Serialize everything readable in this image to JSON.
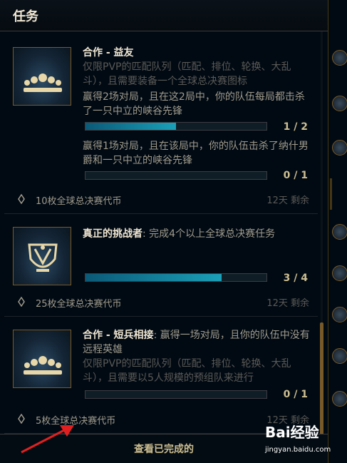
{
  "header": {
    "title": "任务"
  },
  "quests": [
    {
      "name": "合作 - 益友",
      "description": "仅限PVP的匹配队列（匹配、排位、轮换、大乱斗），且需要装备一个全球总决赛图标",
      "objectives": [
        {
          "text": "赢得2场对局，且在这2局中，你的队伍每局都击杀了一只中立的峡谷先锋",
          "progress": 0.5,
          "count": "1 / 2"
        },
        {
          "text": "赢得1场对局，且在该局中，你的队伍击杀了纳什男爵和一只中立的峡谷先锋",
          "progress": 0.0,
          "count": "0 / 1"
        }
      ],
      "reward": "10枚全球总决赛代币",
      "remaining": "12天 剩余",
      "icon": "team-icon"
    },
    {
      "name": "真正的挑战者",
      "title_suffix": ": 完成4个以上全球总决赛任务",
      "objectives": [
        {
          "text": "",
          "progress": 0.75,
          "count": "3 / 4"
        }
      ],
      "reward": "25枚全球总决赛代币",
      "remaining": "12天 剩余",
      "icon": "worlds-trophy-icon"
    },
    {
      "name": "合作 - 短兵相接",
      "title_suffix": ": 赢得一场对局，且你的队伍中没有远程英雄",
      "description": "仅限PVP的匹配队列（匹配、排位、轮换、大乱斗），且需要以5人规模的预组队来进行",
      "objectives": [
        {
          "text": "",
          "progress": 0.0,
          "count": "0 / 1"
        }
      ],
      "reward": "5枚全球总决赛代币",
      "remaining": "12天 剩余",
      "icon": "team-icon"
    }
  ],
  "footer": {
    "view_completed": "查看已完成的"
  },
  "watermark": {
    "logo": "Bai经验",
    "url": "jingyan.baidu.com"
  },
  "colors": {
    "gold": "#cdbe91",
    "progress": "#1aa0b8",
    "background": "#010a13"
  }
}
